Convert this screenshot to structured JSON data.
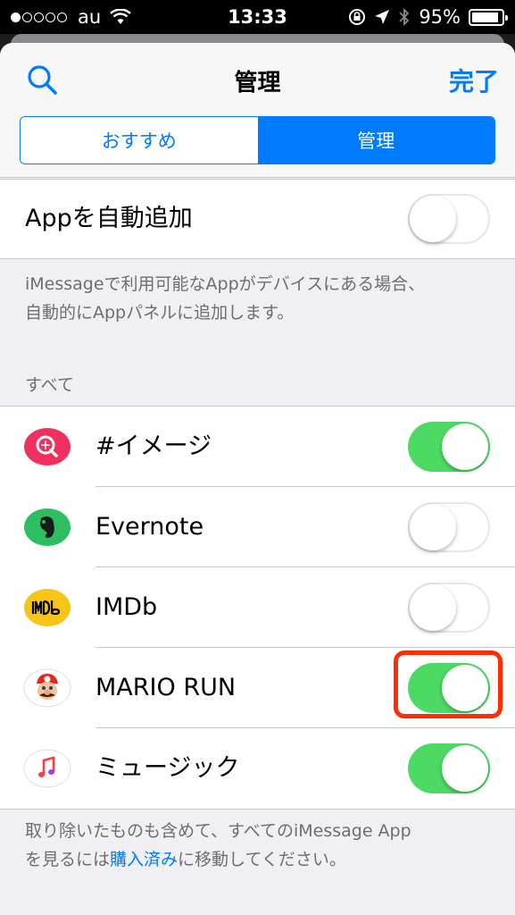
{
  "status_bar": {
    "carrier": "au",
    "time": "13:33",
    "battery": "95%",
    "signal_bars": 1,
    "icons": [
      "signal-dots-icon",
      "wifi-icon",
      "rotation-lock-icon",
      "location-icon",
      "bluetooth-icon",
      "battery-icon"
    ]
  },
  "nav": {
    "title": "管理",
    "done_label": "完了",
    "search_icon": "search-icon"
  },
  "segments": [
    {
      "label": "おすすめ",
      "selected": false
    },
    {
      "label": "管理",
      "selected": true
    }
  ],
  "auto_add": {
    "label": "Appを自動追加",
    "on": false,
    "footer": "iMessageで利用可能なAppがデバイスにある場合、自動的にAppパネルに追加します。",
    "footer_line1": "iMessageで利用可能なAppがデバイスにある場合、",
    "footer_line2": "自動的にAppパネルに追加します。"
  },
  "all_header": "すべて",
  "apps": [
    {
      "name": "#イメージ",
      "icon": "image-search-icon",
      "on": true,
      "color": "#f0315f"
    },
    {
      "name": "Evernote",
      "icon": "evernote-icon",
      "on": false,
      "color": "#2dbe60"
    },
    {
      "name": "IMDb",
      "icon": "imdb-icon",
      "on": false,
      "color": "#f5c518"
    },
    {
      "name": "MARIO RUN",
      "icon": "mario-icon",
      "on": true,
      "color": "#e52521"
    },
    {
      "name": "ミュージック",
      "icon": "music-icon",
      "on": true,
      "color": "#fc3c44"
    }
  ],
  "bottom_footer": {
    "line1": "取り除いたものも含めて、すべてのiMessage App",
    "line2_pre": "を見るには",
    "link": "購入済み",
    "line2_post": "に移動してください。"
  },
  "colors": {
    "accent": "#007aff",
    "toggle_on": "#4cd964",
    "highlight": "#ff2d00"
  }
}
